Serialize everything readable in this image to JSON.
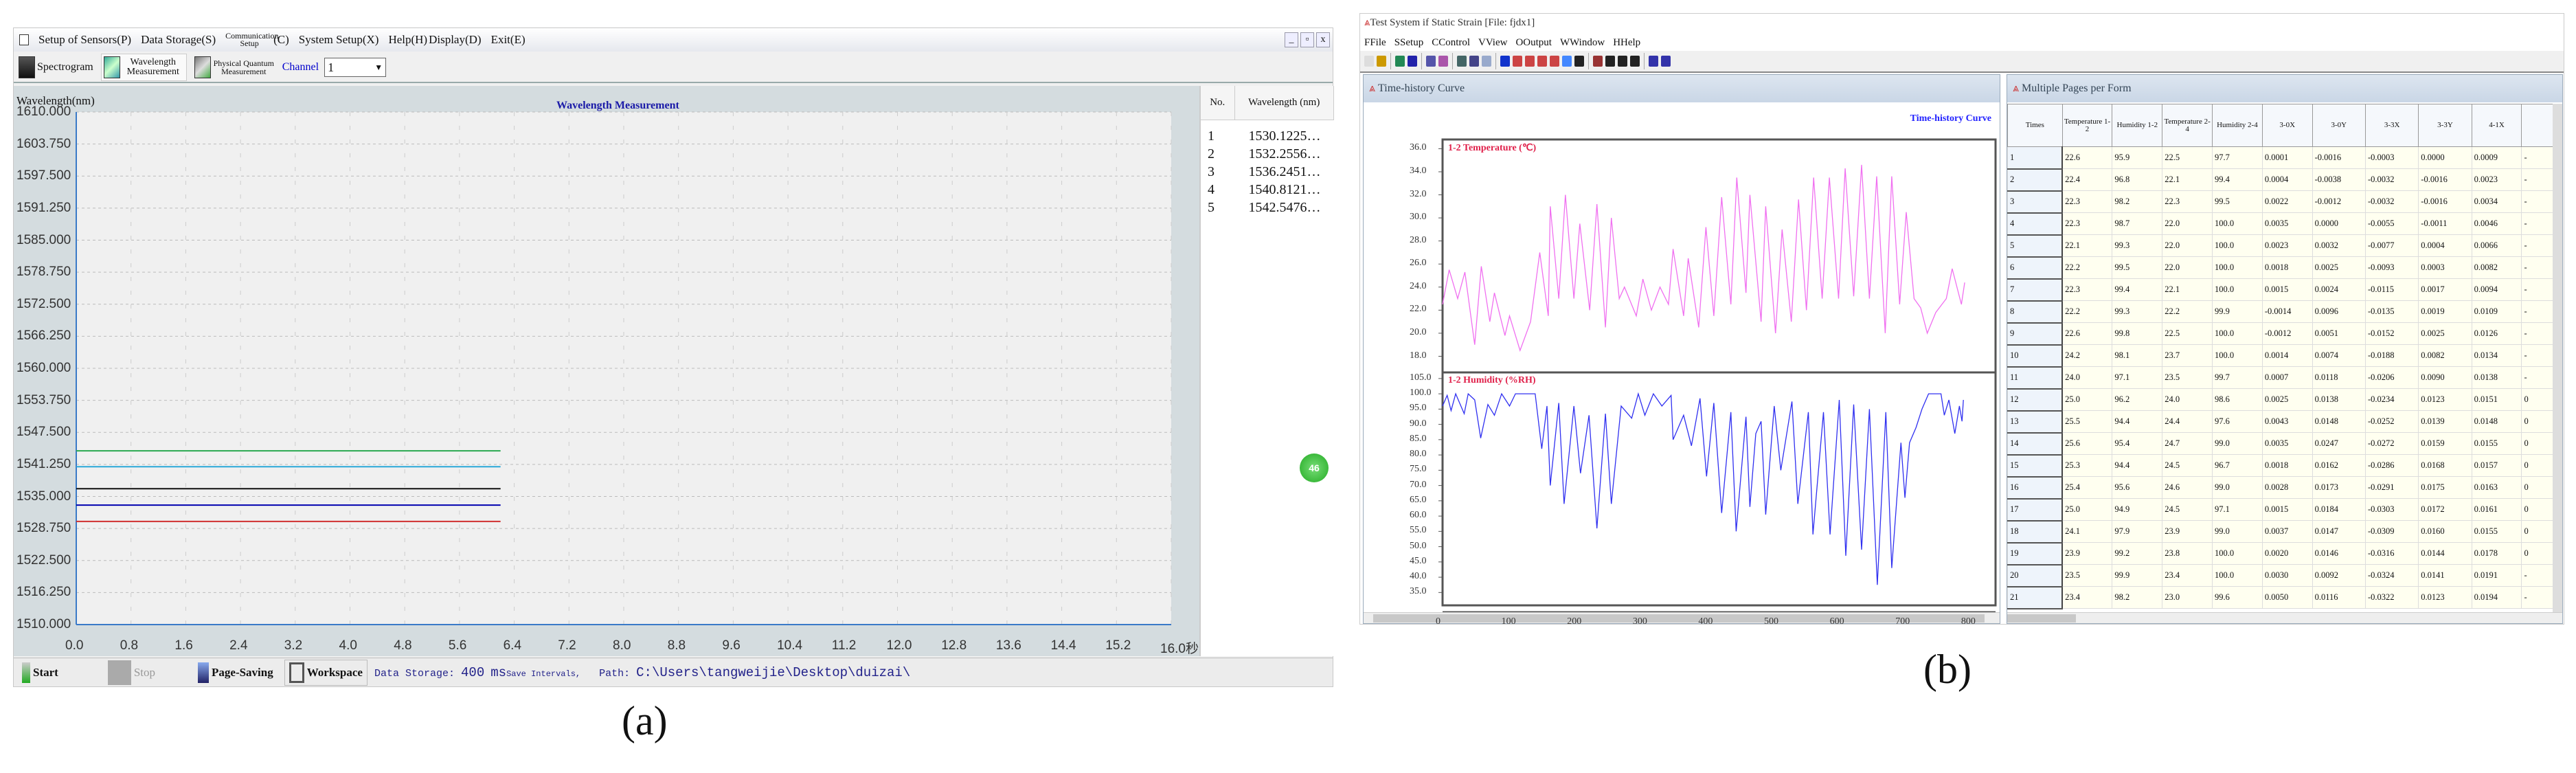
{
  "panel_a": {
    "label": "(a)",
    "menu": [
      "Setup of Sensors(P)",
      "Data Storage(S)",
      "Communication Setup",
      "(C)",
      "System Setup(X)",
      "Help(H)",
      "Display(D)",
      "Exit(E)"
    ],
    "window_buttons": [
      "_",
      "▫",
      "x"
    ],
    "toolbar": {
      "spectrogram": "Spectrogram",
      "wavelength": "Wavelength Measurement",
      "physical": "Physical Quantum Measurement",
      "channel_label": "Channel",
      "channel_value": "1"
    },
    "table": {
      "headers": [
        "No.",
        "Wavelength (nm)"
      ],
      "rows": [
        [
          "1",
          "1530.1225…"
        ],
        [
          "2",
          "1532.2556…"
        ],
        [
          "3",
          "1536.2451…"
        ],
        [
          "4",
          "1540.8121…"
        ],
        [
          "5",
          "1542.5476…"
        ]
      ]
    },
    "bottom": {
      "start": "Start",
      "stop": "Stop",
      "page_saving": "Page-Saving",
      "workspace": "Workspace",
      "data_storage_label": "Data Storage:",
      "interval_value": "400",
      "interval_unit": "ms",
      "save_intervals": "Save Intervals,",
      "path_label": "Path:",
      "path_value": "C:\\Users\\tangweijie\\Desktop\\duizai\\"
    },
    "badge": "46"
  },
  "panel_b": {
    "label": "(b)",
    "title": "Test System if Static Strain [File: fjdx1]",
    "menu": [
      "FFile",
      "SSetup",
      "CControl",
      "VView",
      "OOutput",
      "WWindow",
      "HHelp"
    ],
    "toolbar_icons": [
      "new-icon",
      "open-icon",
      "|",
      "save-icon",
      "export-icon",
      "|",
      "grid-icon",
      "chart-icon",
      "|",
      "settings-icon",
      "table-icon",
      "curve-icon",
      "|",
      "record-icon",
      "zoom-in-icon",
      "zoom-out-icon",
      "zoom-x-icon",
      "zoom-y-icon",
      "move-icon",
      "tool-icon",
      "|",
      "pointer-icon",
      "dropdown-icon",
      "left-arrow-icon",
      "right-arrow-icon",
      "|",
      "tile-h-icon",
      "tile-v-icon"
    ],
    "left_pane_title": "Time-history Curve",
    "right_pane_title": "Multiple Pages per Form",
    "table": {
      "headers": [
        "Times",
        "Temperature 1-2",
        "Humidity 1-2",
        "Temperature 2-4",
        "Humidity 2-4",
        "3-0X",
        "3-0Y",
        "3-3X",
        "3-3Y",
        "4-1X",
        ""
      ],
      "rows": [
        [
          "1",
          "22.6",
          "95.9",
          "22.5",
          "97.7",
          "0.0001",
          "-0.0016",
          "-0.0003",
          "0.0000",
          "0.0009",
          "-"
        ],
        [
          "2",
          "22.4",
          "96.8",
          "22.1",
          "99.4",
          "0.0004",
          "-0.0038",
          "-0.0032",
          "-0.0016",
          "0.0023",
          "-"
        ],
        [
          "3",
          "22.3",
          "98.2",
          "22.3",
          "99.5",
          "0.0022",
          "-0.0012",
          "-0.0032",
          "-0.0016",
          "0.0034",
          "-"
        ],
        [
          "4",
          "22.3",
          "98.7",
          "22.0",
          "100.0",
          "0.0035",
          "0.0000",
          "-0.0055",
          "-0.0011",
          "0.0046",
          "-"
        ],
        [
          "5",
          "22.1",
          "99.3",
          "22.0",
          "100.0",
          "0.0023",
          "0.0032",
          "-0.0077",
          "0.0004",
          "0.0066",
          "-"
        ],
        [
          "6",
          "22.2",
          "99.5",
          "22.0",
          "100.0",
          "0.0018",
          "0.0025",
          "-0.0093",
          "0.0003",
          "0.0082",
          "-"
        ],
        [
          "7",
          "22.3",
          "99.4",
          "22.1",
          "100.0",
          "0.0015",
          "0.0024",
          "-0.0115",
          "0.0017",
          "0.0094",
          "-"
        ],
        [
          "8",
          "22.2",
          "99.3",
          "22.2",
          "99.9",
          "-0.0014",
          "0.0096",
          "-0.0135",
          "0.0019",
          "0.0109",
          "-"
        ],
        [
          "9",
          "22.6",
          "99.8",
          "22.5",
          "100.0",
          "-0.0012",
          "0.0051",
          "-0.0152",
          "0.0025",
          "0.0126",
          "-"
        ],
        [
          "10",
          "24.2",
          "98.1",
          "23.7",
          "100.0",
          "0.0014",
          "0.0074",
          "-0.0188",
          "0.0082",
          "0.0134",
          "-"
        ],
        [
          "11",
          "24.0",
          "97.1",
          "23.5",
          "99.7",
          "0.0007",
          "0.0118",
          "-0.0206",
          "0.0090",
          "0.0138",
          "-"
        ],
        [
          "12",
          "25.0",
          "96.2",
          "24.0",
          "98.6",
          "0.0025",
          "0.0138",
          "-0.0234",
          "0.0123",
          "0.0151",
          "0"
        ],
        [
          "13",
          "25.5",
          "94.4",
          "24.4",
          "97.6",
          "0.0043",
          "0.0148",
          "-0.0252",
          "0.0139",
          "0.0148",
          "0"
        ],
        [
          "14",
          "25.6",
          "95.4",
          "24.7",
          "99.0",
          "0.0035",
          "0.0247",
          "-0.0272",
          "0.0159",
          "0.0155",
          "0"
        ],
        [
          "15",
          "25.3",
          "94.4",
          "24.5",
          "96.7",
          "0.0018",
          "0.0162",
          "-0.0286",
          "0.0168",
          "0.0157",
          "0"
        ],
        [
          "16",
          "25.4",
          "95.6",
          "24.6",
          "99.0",
          "0.0028",
          "0.0173",
          "-0.0291",
          "0.0175",
          "0.0163",
          "0"
        ],
        [
          "17",
          "25.0",
          "94.9",
          "24.5",
          "97.1",
          "0.0015",
          "0.0184",
          "-0.0303",
          "0.0172",
          "0.0161",
          "0"
        ],
        [
          "18",
          "24.1",
          "97.9",
          "23.9",
          "99.0",
          "0.0037",
          "0.0147",
          "-0.0309",
          "0.0160",
          "0.0155",
          "0"
        ],
        [
          "19",
          "23.9",
          "99.2",
          "23.8",
          "100.0",
          "0.0020",
          "0.0146",
          "-0.0316",
          "0.0144",
          "0.0178",
          "0"
        ],
        [
          "20",
          "23.5",
          "99.9",
          "23.4",
          "100.0",
          "0.0030",
          "0.0092",
          "-0.0324",
          "0.0141",
          "0.0191",
          "-"
        ],
        [
          "21",
          "23.4",
          "98.2",
          "23.0",
          "99.6",
          "0.0050",
          "0.0116",
          "-0.0322",
          "0.0123",
          "0.0194",
          "-"
        ]
      ]
    }
  },
  "chart_data": [
    {
      "type": "line",
      "title": "Wavelength Measurement",
      "ylabel": "Wavelength(nm)",
      "xlabel": "",
      "xlim": [
        0,
        16
      ],
      "ylim": [
        1510,
        1610
      ],
      "x_ticks": [
        "0.0",
        "0.8",
        "1.6",
        "2.4",
        "3.2",
        "4.0",
        "4.8",
        "5.6",
        "6.4",
        "7.2",
        "8.0",
        "8.8",
        "9.6",
        "10.4",
        "11.2",
        "12.0",
        "12.8",
        "13.6",
        "14.4",
        "15.2",
        "16.0秒"
      ],
      "y_ticks": [
        "1510.000",
        "1516.250",
        "1522.500",
        "1528.750",
        "1535.000",
        "1541.250",
        "1547.500",
        "1553.750",
        "1560.000",
        "1566.250",
        "1572.500",
        "1578.750",
        "1585.000",
        "1591.250",
        "1597.500",
        "1603.750",
        "1610.000"
      ],
      "grid": true,
      "series": [
        {
          "name": "1",
          "color": "#d03030",
          "x": [
            0,
            6.2
          ],
          "y": [
            1530.12,
            1530.12
          ]
        },
        {
          "name": "2",
          "color": "#0000b0",
          "x": [
            0,
            6.2
          ],
          "y": [
            1533.3,
            1533.3
          ]
        },
        {
          "name": "3",
          "color": "#111111",
          "x": [
            0,
            6.2
          ],
          "y": [
            1536.5,
            1536.5
          ]
        },
        {
          "name": "4",
          "color": "#2aa8d8",
          "x": [
            0,
            6.2
          ],
          "y": [
            1540.8,
            1540.8
          ]
        },
        {
          "name": "5",
          "color": "#2aa850",
          "x": [
            0,
            6.2
          ],
          "y": [
            1543.9,
            1543.9
          ]
        }
      ]
    },
    {
      "type": "line",
      "title": "Time-history Curve",
      "series_label": "1-2 Temperature (℃)",
      "xlim": [
        0,
        842
      ],
      "ylim": [
        16.6,
        36.8
      ],
      "y_ticks": [
        "18.0",
        "20.0",
        "22.0",
        "24.0",
        "26.0",
        "28.0",
        "30.0",
        "32.0",
        "34.0",
        "36.0"
      ],
      "color": "#f070f0",
      "x": [
        0,
        10,
        23,
        34,
        49,
        59,
        72,
        79,
        95,
        102,
        118,
        134,
        148,
        161,
        164,
        177,
        187,
        200,
        209,
        224,
        235,
        248,
        257,
        269,
        277,
        295,
        305,
        318,
        331,
        344,
        351,
        367,
        374,
        390,
        401,
        413,
        425,
        439,
        448,
        462,
        468,
        485,
        492,
        507,
        517,
        531,
        542,
        554,
        565,
        578,
        589,
        603,
        613,
        626,
        638,
        650,
        661,
        674,
        684,
        696,
        706,
        718,
        728,
        738,
        751,
        767,
        776,
        790,
        795
      ],
      "y": [
        22.5,
        25.5,
        23,
        25.3,
        19,
        25.8,
        21,
        23.5,
        19.8,
        21.5,
        18.5,
        21,
        27,
        21.5,
        31,
        23,
        32,
        23,
        29.5,
        22,
        31.2,
        20.5,
        30,
        23,
        24,
        21.5,
        24.7,
        22,
        24,
        22.5,
        27.3,
        21.5,
        26.5,
        20.5,
        29.2,
        21.5,
        31.8,
        22.5,
        33.5,
        23.5,
        32,
        21,
        31,
        20,
        29,
        21,
        31.6,
        22,
        33.5,
        23,
        33.5,
        23,
        34.3,
        23.2,
        34.6,
        23,
        33.6,
        20,
        33.6,
        22.5,
        30.5,
        23,
        22.2,
        20,
        21.8,
        23,
        25.6,
        22.5,
        24.4
      ]
    },
    {
      "type": "line",
      "series_label": "1-2 Humidity (%RH)",
      "xlim": [
        0,
        842
      ],
      "ylim": [
        30.8,
        107
      ],
      "x_ticks": [
        "0",
        "100",
        "200",
        "300",
        "400",
        "500",
        "600",
        "700",
        "800"
      ],
      "y_ticks": [
        "35.0",
        "40.0",
        "45.0",
        "50.0",
        "55.0",
        "60.0",
        "65.0",
        "70.0",
        "75.0",
        "80.0",
        "85.0",
        "90.0",
        "95.0",
        "100.0",
        "105.0"
      ],
      "color": "#3030f0",
      "x": [
        0,
        7,
        13,
        20,
        33,
        39,
        49,
        58,
        69,
        79,
        90,
        102,
        111,
        141,
        151,
        159,
        164,
        177,
        185,
        200,
        210,
        223,
        235,
        248,
        257,
        272,
        288,
        298,
        308,
        321,
        334,
        348,
        351,
        367,
        379,
        392,
        402,
        413,
        425,
        439,
        447,
        462,
        468,
        477,
        485,
        492,
        505,
        515,
        532,
        541,
        557,
        564,
        580,
        590,
        604,
        614,
        626,
        638,
        650,
        662,
        675,
        684,
        698,
        704,
        711,
        721,
        730,
        740,
        759,
        764,
        771,
        780,
        787,
        791,
        793
      ],
      "y": [
        96,
        99.5,
        94.5,
        100,
        93.5,
        100,
        98,
        85.5,
        96.5,
        93,
        100,
        96,
        100,
        100,
        82,
        96,
        70,
        97,
        64,
        96,
        74,
        93,
        56,
        93.5,
        64,
        96,
        92,
        100,
        93,
        100,
        96,
        99.5,
        85,
        93,
        83,
        98.5,
        73,
        97,
        61,
        94,
        55,
        92.5,
        63,
        87,
        91,
        60.5,
        96,
        75,
        97.5,
        64,
        94,
        54,
        94,
        54,
        98,
        47,
        96.5,
        49,
        95,
        37.5,
        94,
        43,
        84,
        66,
        84,
        89,
        95,
        100,
        100,
        93,
        98,
        87,
        96,
        91,
        98
      ]
    }
  ]
}
